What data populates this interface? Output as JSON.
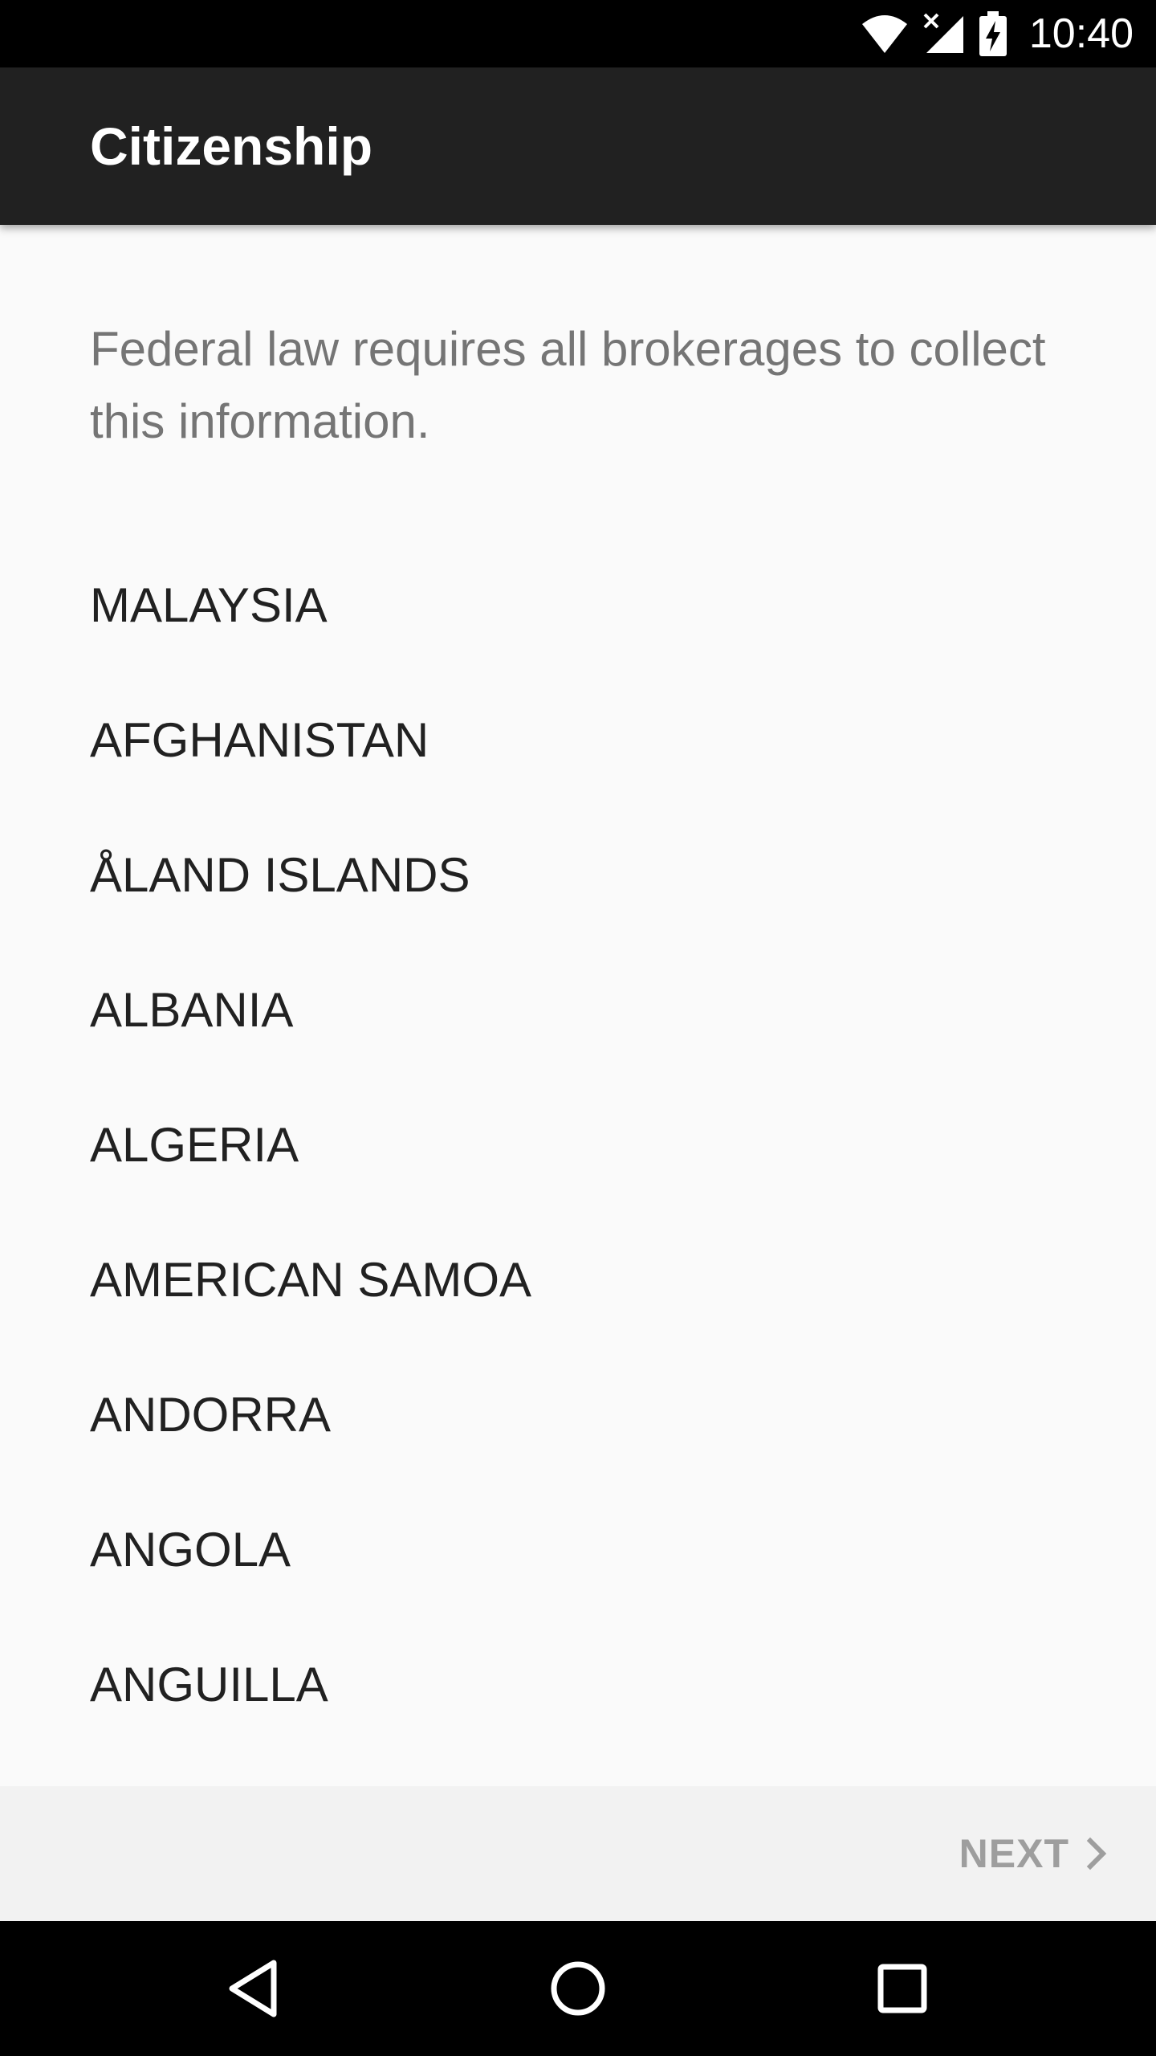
{
  "status_bar": {
    "time": "10:40",
    "icons": [
      "wifi-icon",
      "signal-icon",
      "battery-charging-icon"
    ]
  },
  "app_bar": {
    "title": "Citizenship"
  },
  "description": "Federal law requires all brokerages to collect this information.",
  "countries": [
    "MALAYSIA",
    "AFGHANISTAN",
    "ÅLAND ISLANDS",
    "ALBANIA",
    "ALGERIA",
    "AMERICAN SAMOA",
    "ANDORRA",
    "ANGOLA",
    "ANGUILLA"
  ],
  "footer": {
    "next_label": "NEXT",
    "next_icon": "chevron-right-icon"
  },
  "nav_bar": {
    "buttons": [
      "back-icon",
      "home-icon",
      "recents-icon"
    ]
  },
  "colors": {
    "app_bar": "#212121",
    "background": "#fafafa",
    "description_text": "#757575",
    "list_text": "#212121",
    "footer_background": "#f2f2f2",
    "next_disabled": "#9e9e9e"
  }
}
